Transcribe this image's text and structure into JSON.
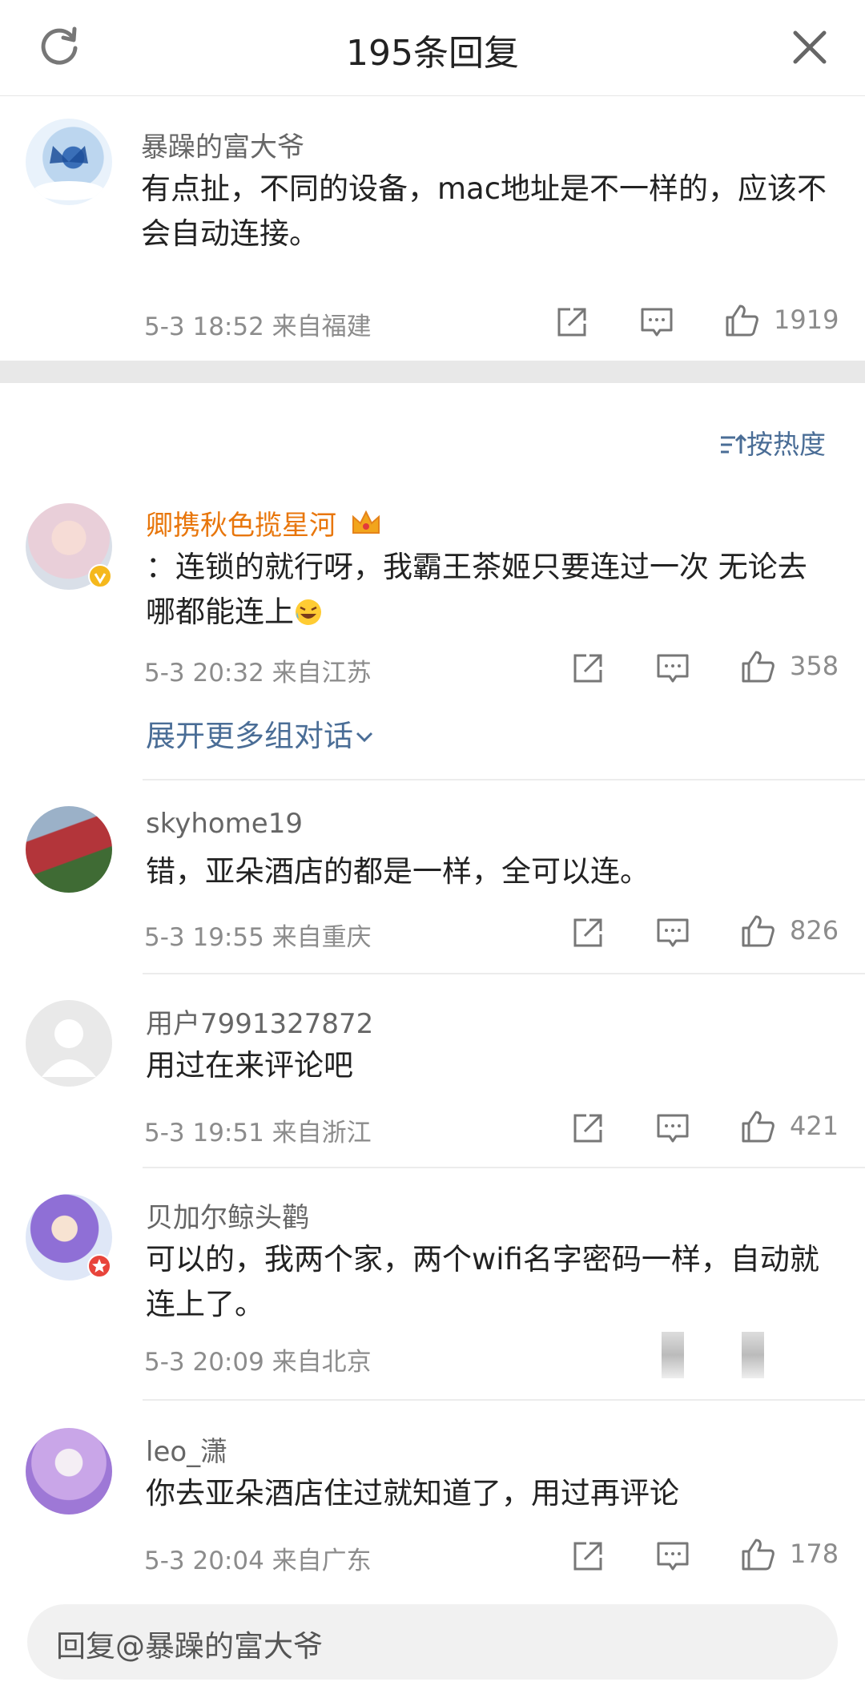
{
  "header": {
    "title": "195条回复"
  },
  "root": {
    "name": "暴躁的富大爷",
    "text": "有点扯，不同的设备，mac地址是不一样的，应该不会自动连接。",
    "meta": "5-3 18:52 来自福建",
    "likes": "1919"
  },
  "sort_label": "按热度",
  "comments": [
    {
      "name": "卿携秋色揽星河",
      "text": "：连锁的就行呀，我霸王茶姬只要连过一次 无论去哪都能连上",
      "meta": "5-3 20:32 来自江苏",
      "likes": "358"
    },
    {
      "name": "skyhome19",
      "text": "错，亚朵酒店的都是一样，全可以连。",
      "meta": "5-3 19:55 来自重庆",
      "likes": "826"
    },
    {
      "name": "用户7991327872",
      "text": "用过在来评论吧",
      "meta": "5-3 19:51 来自浙江",
      "likes": "421"
    },
    {
      "name": "贝加尔鲸头鹳",
      "text": "可以的，我两个家，两个wifi名字密码一样，自动就连上了。",
      "meta": "5-3 20:09 来自北京",
      "likes": ""
    },
    {
      "name": "leo_潇",
      "text": "你去亚朵酒店住过就知道了，用过再评论",
      "meta": "5-3 20:04 来自广东",
      "likes": "178"
    }
  ],
  "expand_label": "展开更多组对话",
  "reply_placeholder": "回复@暴躁的富大爷",
  "colors": {
    "link": "#4a6d96",
    "vip_name": "#e8760b",
    "meta": "#8c8c8c"
  },
  "icons": [
    "refresh-icon",
    "close-icon",
    "share-icon",
    "comment-icon",
    "like-icon",
    "sort-icon",
    "chevron-down-icon",
    "crown-icon",
    "verified-badge-icon",
    "laughing-emoji-icon"
  ]
}
